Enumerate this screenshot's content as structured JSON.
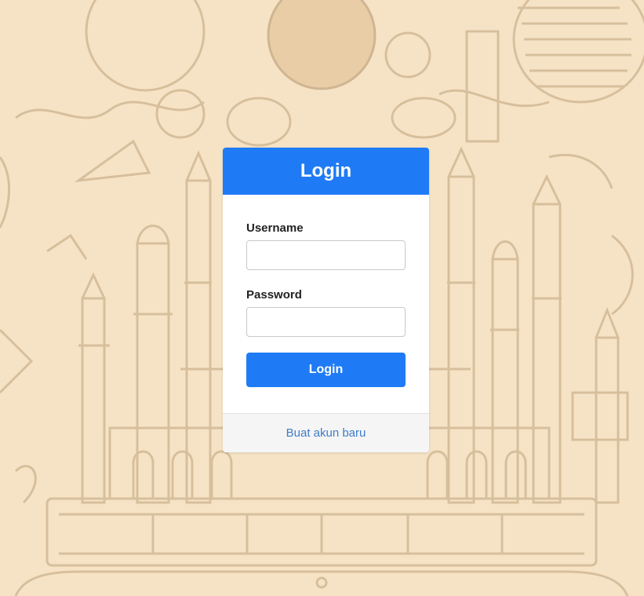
{
  "colors": {
    "background": "#f6e3c6",
    "sketch_stroke": "#d2b995",
    "accent": "#1f7bf5",
    "link": "#3d7cc9"
  },
  "background": {
    "icon": "mosque-sketch-illustration"
  },
  "login_card": {
    "title": "Login",
    "username": {
      "label": "Username",
      "value": "",
      "placeholder": ""
    },
    "password": {
      "label": "Password",
      "value": "",
      "placeholder": ""
    },
    "submit_label": "Login",
    "register_link": "Buat akun baru"
  }
}
